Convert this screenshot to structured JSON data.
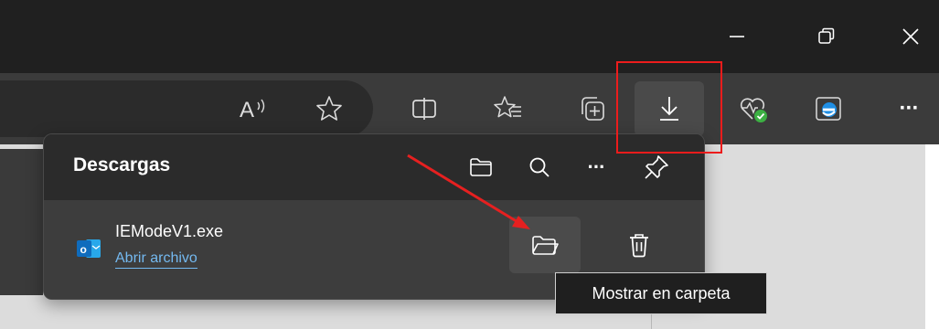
{
  "titlebar": {
    "buttons": [
      {
        "name": "minimize-icon"
      },
      {
        "name": "restore-icon"
      },
      {
        "name": "close-icon"
      }
    ]
  },
  "toolbar": {
    "icons": [
      "read-aloud-icon",
      "favorite-star-icon",
      "split-screen-icon",
      "favorites-icon",
      "collections-icon",
      "downloads-icon",
      "browser-essentials-icon",
      "ie-mode-icon",
      "more-icon"
    ],
    "read_aloud_glyph": "A",
    "more_glyph": "···"
  },
  "downloads": {
    "title": "Descargas",
    "header_more_glyph": "···",
    "item": {
      "file_name": "IEModeV1.exe",
      "action_link": "Abrir archivo",
      "icon_badge": "o"
    },
    "tooltip": "Mostrar en carpeta"
  },
  "colors": {
    "titlebar": "#202020",
    "toolbar": "#3b3b3b",
    "panel": "#2e2e2e",
    "link": "#74b9f0",
    "highlight": "#ec1c1c",
    "outlook_blue": "#0f6cbd"
  }
}
